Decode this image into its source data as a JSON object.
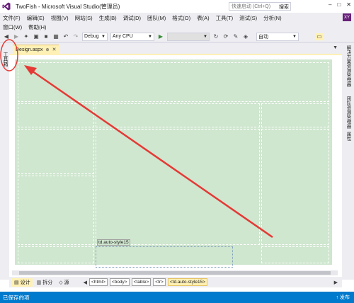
{
  "window": {
    "title": "TwoFish - Microsoft Visual Studio(管理员)",
    "quick_launch_placeholder": "快速启动 (Ctrl+Q)",
    "quick_launch_search": "搜索",
    "user_initials": "XY"
  },
  "menu": {
    "items": [
      "文件(F)",
      "编辑(E)",
      "视图(V)",
      "网站(S)",
      "生成(B)",
      "调试(D)",
      "团队(M)",
      "格式(O)",
      "表(A)",
      "工具(T)",
      "测试(S)",
      "分析(N)"
    ],
    "row2": [
      "窗口(W)",
      "帮助(H)"
    ]
  },
  "toolbar": {
    "config": "Debug",
    "platform": "Any CPU",
    "auto": "自动"
  },
  "left_strip": {
    "toolbox_label": "工具箱"
  },
  "right_strip": {
    "tabs": [
      "解决方案资源管理器",
      "团队资源管理器",
      "属性"
    ]
  },
  "document": {
    "tab_label": "Design.aspx",
    "selected_cell_label": "td.auto-style15"
  },
  "bottom": {
    "views": [
      "设计",
      "拆分",
      "源"
    ],
    "crumbs": [
      "<html>",
      "<body>",
      "<table>",
      "<tr>",
      "<td.auto-style15>"
    ]
  },
  "status": {
    "text": "已保存的项",
    "publish": "↑ 发布"
  },
  "colors": {
    "accent": "#007acc",
    "tab_active": "#fff1b5",
    "design_bg": "#cfe6cf",
    "annotation": "#e53935",
    "vs_purple": "#68217a"
  }
}
